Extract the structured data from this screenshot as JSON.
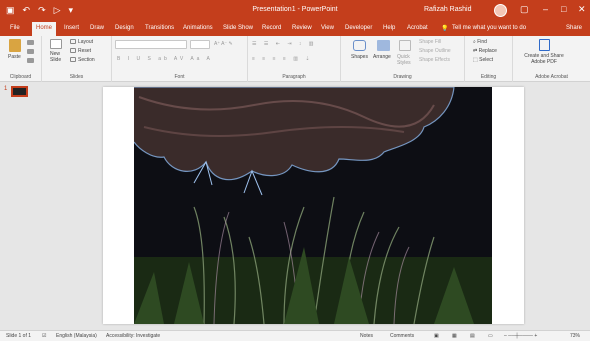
{
  "titlebar": {
    "title": "Presentation1 - PowerPoint",
    "user": "Rafizah Rashid",
    "qat_save_icon": "save-icon",
    "minimize": "–",
    "restore": "□",
    "close": "✕",
    "ribbon_display": "▢"
  },
  "tabs": [
    "File",
    "Home",
    "Insert",
    "Draw",
    "Design",
    "Transitions",
    "Animations",
    "Slide Show",
    "Record",
    "Review",
    "View",
    "Developer",
    "Help",
    "Acrobat"
  ],
  "active_tab": "Home",
  "tell_me": "Tell me what you want to do",
  "share": "Share",
  "ribbon": {
    "clipboard": {
      "label": "Clipboard",
      "paste": "Paste"
    },
    "slides": {
      "label": "Slides",
      "new_slide": "New Slide",
      "layout": "Layout",
      "reset": "Reset",
      "section": "Section"
    },
    "font": {
      "label": "Font"
    },
    "paragraph": {
      "label": "Paragraph"
    },
    "drawing": {
      "label": "Drawing",
      "shapes": "Shapes",
      "arrange": "Arrange",
      "quick_styles": "Quick Styles",
      "shape_fill": "Shape Fill",
      "shape_outline": "Shape Outline",
      "shape_effects": "Shape Effects"
    },
    "editing": {
      "label": "Editing",
      "find": "Find",
      "replace": "Replace",
      "select": "Select"
    },
    "acrobat": {
      "label": "Adobe Acrobat",
      "create_share": "Create and Share Adobe PDF"
    }
  },
  "thumbnails": {
    "slide_number": "1"
  },
  "status": {
    "slide": "Slide 1 of 1",
    "language": "English (Malaysia)",
    "accessibility": "Accessibility: Investigate",
    "notes": "Notes",
    "comments": "Comments",
    "zoom": "73%"
  },
  "colors": {
    "accent": "#c43e1c",
    "ribbon": "#f3f3f3"
  }
}
